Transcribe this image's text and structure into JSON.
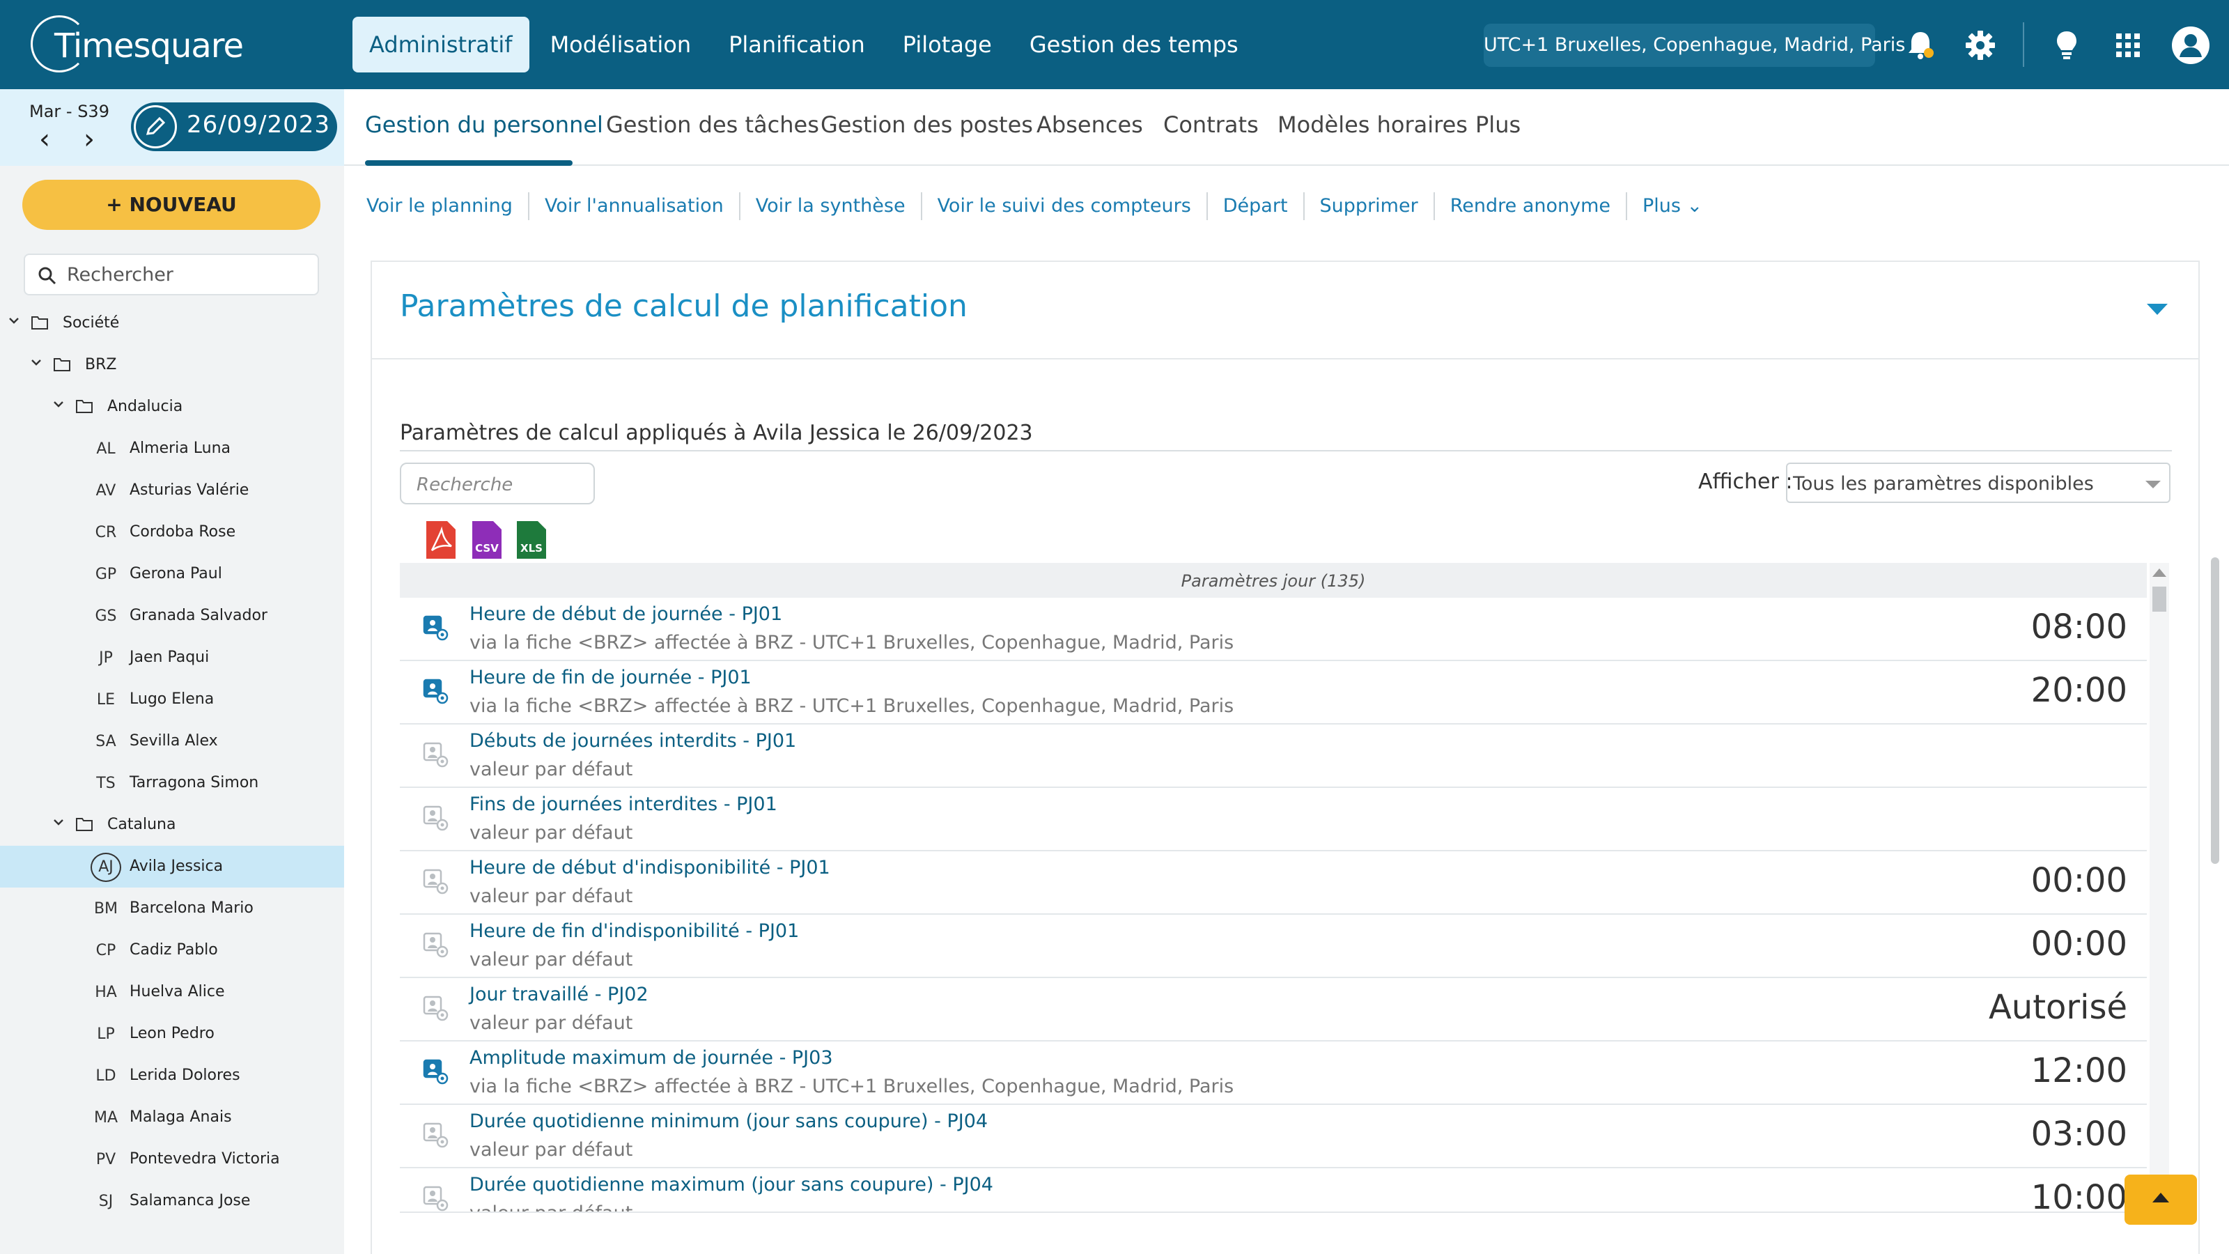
{
  "app": {
    "logo_text": "Timesquare",
    "timezone": "UTC+1 Bruxelles, Copenhague, Madrid, Paris"
  },
  "topnav": [
    "Administratif",
    "Modélisation",
    "Planification",
    "Pilotage",
    "Gestion des temps"
  ],
  "date": {
    "week": "Mar - S39",
    "value": "26/09/2023"
  },
  "subnav": [
    "Gestion du personnel",
    "Gestion des tâches",
    "Gestion des postes",
    "Absences",
    "Contrats",
    "Modèles horaires",
    "Plus"
  ],
  "sidebar": {
    "new_button": "NOUVEAU",
    "search_placeholder": "Rechercher",
    "tree": [
      {
        "label": "Société"
      },
      {
        "label": "BRZ"
      },
      {
        "label": "Andalucia"
      },
      {
        "label": "Cataluna"
      }
    ],
    "people_andalucia": [
      {
        "initials": "AL",
        "name": "Almeria Luna"
      },
      {
        "initials": "AV",
        "name": "Asturias Valérie"
      },
      {
        "initials": "CR",
        "name": "Cordoba Rose"
      },
      {
        "initials": "GP",
        "name": "Gerona Paul"
      },
      {
        "initials": "GS",
        "name": "Granada Salvador"
      },
      {
        "initials": "JP",
        "name": "Jaen Paqui"
      },
      {
        "initials": "LE",
        "name": "Lugo Elena"
      },
      {
        "initials": "SA",
        "name": "Sevilla Alex"
      },
      {
        "initials": "TS",
        "name": "Tarragona Simon"
      }
    ],
    "people_cataluna": [
      {
        "initials": "AJ",
        "name": "Avila Jessica"
      },
      {
        "initials": "BM",
        "name": "Barcelona Mario"
      },
      {
        "initials": "CP",
        "name": "Cadiz Pablo"
      },
      {
        "initials": "HA",
        "name": "Huelva Alice"
      },
      {
        "initials": "LP",
        "name": "Leon Pedro"
      },
      {
        "initials": "LD",
        "name": "Lerida Dolores"
      },
      {
        "initials": "MA",
        "name": "Malaga Anais"
      },
      {
        "initials": "PV",
        "name": "Pontevedra Victoria"
      },
      {
        "initials": "SJ",
        "name": "Salamanca Jose"
      }
    ]
  },
  "actions": [
    "Voir le planning",
    "Voir l'annualisation",
    "Voir la synthèse",
    "Voir le suivi des compteurs",
    "Départ",
    "Supprimer",
    "Rendre anonyme",
    "Plus"
  ],
  "card": {
    "title": "Paramètres de calcul de planification",
    "subtitle": "Paramètres de calcul appliqués à Avila Jessica le 26/09/2023",
    "search_placeholder": "Recherche",
    "afficher_label": "Afficher :",
    "afficher_value": "Tous les paramètres disponibles",
    "exports": [
      "PDF",
      "CSV",
      "XLS"
    ],
    "table_header": "Paramètres jour (135)"
  },
  "params": [
    {
      "title": "Heure de début de journée - PJ01",
      "source": "via la fiche <BRZ> affectée à BRZ - UTC+1 Bruxelles, Copenhague, Madrid, Paris",
      "value": "08:00",
      "active": true
    },
    {
      "title": "Heure de fin de journée - PJ01",
      "source": "via la fiche <BRZ> affectée à BRZ - UTC+1 Bruxelles, Copenhague, Madrid, Paris",
      "value": "20:00",
      "active": true
    },
    {
      "title": "Débuts de journées interdits - PJ01",
      "source": "valeur par défaut",
      "value": "",
      "active": false
    },
    {
      "title": "Fins de journées interdites - PJ01",
      "source": "valeur par défaut",
      "value": "",
      "active": false
    },
    {
      "title": "Heure de début d'indisponibilité - PJ01",
      "source": "valeur par défaut",
      "value": "00:00",
      "active": false
    },
    {
      "title": "Heure de fin d'indisponibilité - PJ01",
      "source": "valeur par défaut",
      "value": "00:00",
      "active": false
    },
    {
      "title": "Jour travaillé - PJ02",
      "source": "valeur par défaut",
      "value": "Autorisé",
      "active": false
    },
    {
      "title": "Amplitude maximum de journée - PJ03",
      "source": "via la fiche <BRZ> affectée à BRZ - UTC+1 Bruxelles, Copenhague, Madrid, Paris",
      "value": "12:00",
      "active": true
    },
    {
      "title": "Durée quotidienne minimum (jour sans coupure) - PJ04",
      "source": "valeur par défaut",
      "value": "03:00",
      "active": false
    },
    {
      "title": "Durée quotidienne maximum (jour sans coupure) - PJ04",
      "source": "valeur par défaut",
      "value": "10:00",
      "active": false
    }
  ],
  "colors": {
    "primary": "#0b5f82",
    "accent": "#1a8fc4",
    "new_button": "#f6c043",
    "selected_row": "#c9e8f7"
  }
}
